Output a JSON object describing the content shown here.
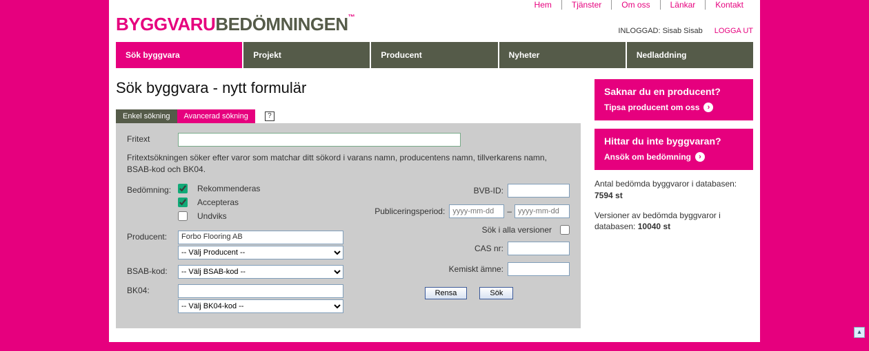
{
  "topnav": [
    "Hem",
    "Tjänster",
    "Om oss",
    "Länkar",
    "Kontakt"
  ],
  "logo": {
    "part1": "BYGGVARU",
    "part2": "BEDÖMNINGEN",
    "tm": "™"
  },
  "login": {
    "label": "INLOGGAD:",
    "user": "Sisab Sisab",
    "logout": "LOGGA UT"
  },
  "mainnav": [
    {
      "label": "Sök byggvara",
      "active": true
    },
    {
      "label": "Projekt",
      "active": false
    },
    {
      "label": "Producent",
      "active": false
    },
    {
      "label": "Nyheter",
      "active": false
    },
    {
      "label": "Nedladdning",
      "active": false
    }
  ],
  "page_title": "Sök byggvara - nytt formulär",
  "subtabs": {
    "simple": "Enkel sökning",
    "advanced": "Avancerad sökning"
  },
  "help_icon": "?",
  "form": {
    "fritext_label": "Fritext",
    "fritext_help": "Fritextsökningen söker efter varor som matchar ditt sökord i varans namn, producentens namn, tillverkarens namn, BSAB-kod och BK04.",
    "bedomning_label": "Bedömning:",
    "bedomning_opts": {
      "rec": "Rekommenderas",
      "acc": "Accepteras",
      "und": "Undviks"
    },
    "producent_label": "Producent:",
    "producent_value": "Forbo Flooring AB",
    "producent_placeholder": "-- Välj Producent --",
    "bsab_label": "BSAB-kod:",
    "bsab_placeholder": "-- Välj BSAB-kod --",
    "bk04_label": "BK04:",
    "bk04_placeholder": "-- Välj BK04-kod --",
    "bvbid_label": "BVB-ID:",
    "pub_label": "Publiceringsperiod:",
    "pub_placeholder": "yyyy-mm-dd",
    "allver_label": "Sök i alla versioner",
    "cas_label": "CAS nr:",
    "kem_label": "Kemiskt ämne:",
    "btn_reset": "Rensa",
    "btn_search": "Sök"
  },
  "cta1": {
    "title": "Saknar du en producent?",
    "link": "Tipsa producent om oss"
  },
  "cta2": {
    "title": "Hittar du inte byggvaran?",
    "link": "Ansök om bedömning"
  },
  "stats": {
    "line1_pre": "Antal bedömda byggvaror i databasen:",
    "line1_val": "7594 st",
    "line2_pre": "Versioner av bedömda byggvaror i databasen:",
    "line2_val": "10040 st"
  }
}
